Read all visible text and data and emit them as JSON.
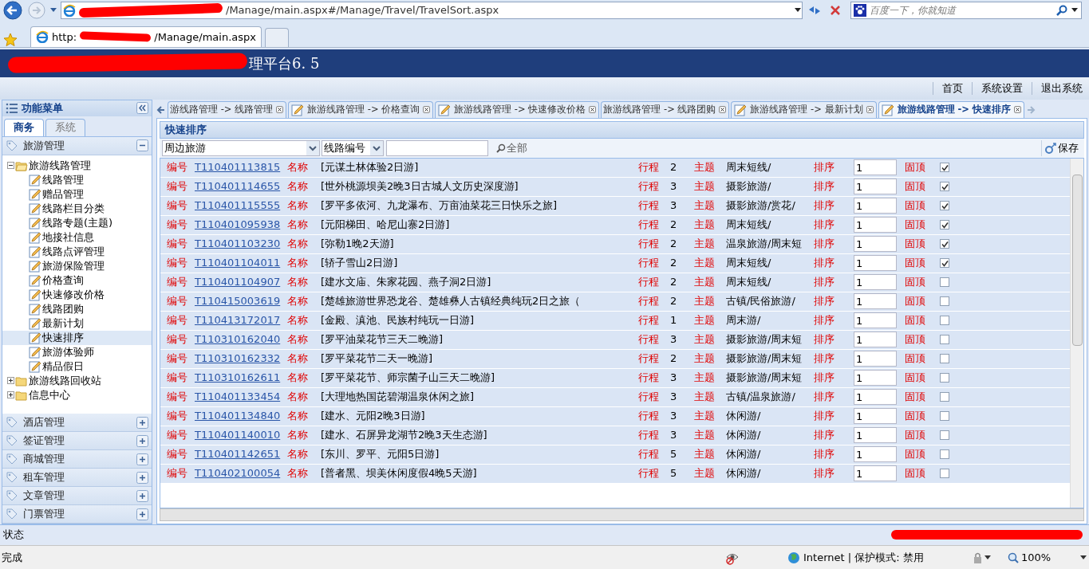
{
  "browser": {
    "address": "/Manage/main.aspx#/Manage/Travel/TravelSort.aspx",
    "search_placeholder": "百度一下，你就知道",
    "tabs": [
      {
        "label_start": "http:",
        "label_end": "/Manage/main.aspx",
        "selected": true
      }
    ]
  },
  "app": {
    "title": "理平台6. 5",
    "top_links": [
      "首页",
      "系统设置",
      "退出系统"
    ]
  },
  "sidebar": {
    "title": "功能菜单",
    "tabs": [
      {
        "label": "商务",
        "selected": true
      },
      {
        "label": "系统",
        "selected": false
      }
    ],
    "sections": [
      {
        "label": "旅游管理",
        "expanded": true,
        "tree": [
          {
            "label": "旅游线路管理",
            "expanded": true,
            "children": [
              {
                "label": "线路管理",
                "selected": false
              },
              {
                "label": "赠品管理",
                "selected": false
              },
              {
                "label": "线路栏目分类",
                "selected": false
              },
              {
                "label": "线路专题(主题)",
                "selected": false
              },
              {
                "label": "地接社信息",
                "selected": false
              },
              {
                "label": "线路点评管理",
                "selected": false
              },
              {
                "label": "旅游保险管理",
                "selected": false
              },
              {
                "label": "价格查询",
                "selected": false
              },
              {
                "label": "快速修改价格",
                "selected": false
              },
              {
                "label": "线路团购",
                "selected": false
              },
              {
                "label": "最新计划",
                "selected": false
              },
              {
                "label": "快速排序",
                "selected": true
              },
              {
                "label": "旅游体验师",
                "selected": false
              },
              {
                "label": "精品假日",
                "selected": false
              }
            ]
          },
          {
            "label": "旅游线路回收站",
            "expanded": false
          },
          {
            "label": "信息中心",
            "expanded": false
          }
        ]
      },
      {
        "label": "酒店管理",
        "expanded": false
      },
      {
        "label": "签证管理",
        "expanded": false
      },
      {
        "label": "商城管理",
        "expanded": false
      },
      {
        "label": "租车管理",
        "expanded": false
      },
      {
        "label": "文章管理",
        "expanded": false
      },
      {
        "label": "门票管理",
        "expanded": false
      }
    ]
  },
  "page_tabs": [
    {
      "label": "游线路管理 -> 线路管理",
      "icon": false,
      "selected": false
    },
    {
      "label": "旅游线路管理 -> 价格查询",
      "icon": true,
      "selected": false
    },
    {
      "label": "旅游线路管理 -> 快速修改价格",
      "icon": true,
      "selected": false
    },
    {
      "label": "旅游线路管理 -> 线路团购",
      "icon": false,
      "selected": false
    },
    {
      "label": "旅游线路管理 -> 最新计划",
      "icon": true,
      "selected": false
    },
    {
      "label": "旅游线路管理 -> 快速排序",
      "icon": true,
      "selected": true
    }
  ],
  "panel": {
    "title": "快速排序",
    "category": "周边旅游",
    "field": "线路编号",
    "search_button": "全部",
    "save_button": "保存",
    "rows": [
      {
        "code_label": "编号",
        "code": "T110401113815",
        "name_label": "名称",
        "name": "[元谋土林体验2日游]",
        "days_label": "行程",
        "days": "2",
        "theme_label": "主题",
        "theme": "周末短线/",
        "order_label": "排序",
        "order": "1",
        "top_label": "固顶",
        "pinned": true
      },
      {
        "code_label": "编号",
        "code": "T110401114655",
        "name_label": "名称",
        "name": "[世外桃源坝美2晚3日古城人文历史深度游]",
        "days_label": "行程",
        "days": "3",
        "theme_label": "主题",
        "theme": "摄影旅游/",
        "order_label": "排序",
        "order": "1",
        "top_label": "固顶",
        "pinned": true
      },
      {
        "code_label": "编号",
        "code": "T110401115555",
        "name_label": "名称",
        "name": "[罗平多依河、九龙瀑布、万亩油菜花三日快乐之旅]",
        "days_label": "行程",
        "days": "3",
        "theme_label": "主题",
        "theme": "摄影旅游/赏花/",
        "order_label": "排序",
        "order": "1",
        "top_label": "固顶",
        "pinned": true
      },
      {
        "code_label": "编号",
        "code": "T110401095938",
        "name_label": "名称",
        "name": "[元阳梯田、哈尼山寨2日游]",
        "days_label": "行程",
        "days": "2",
        "theme_label": "主题",
        "theme": "周末短线/",
        "order_label": "排序",
        "order": "1",
        "top_label": "固顶",
        "pinned": true
      },
      {
        "code_label": "编号",
        "code": "T110401103230",
        "name_label": "名称",
        "name": "[弥勒1晚2天游]",
        "days_label": "行程",
        "days": "2",
        "theme_label": "主题",
        "theme": "温泉旅游/周末短",
        "order_label": "排序",
        "order": "1",
        "top_label": "固顶",
        "pinned": true
      },
      {
        "code_label": "编号",
        "code": "T110401104011",
        "name_label": "名称",
        "name": "[轿子雪山2日游]",
        "days_label": "行程",
        "days": "2",
        "theme_label": "主题",
        "theme": "周末短线/",
        "order_label": "排序",
        "order": "1",
        "top_label": "固顶",
        "pinned": true
      },
      {
        "code_label": "编号",
        "code": "T110401104907",
        "name_label": "名称",
        "name": "[建水文庙、朱家花园、燕子洞2日游]",
        "days_label": "行程",
        "days": "2",
        "theme_label": "主题",
        "theme": "周末短线/",
        "order_label": "排序",
        "order": "1",
        "top_label": "固顶",
        "pinned": false
      },
      {
        "code_label": "编号",
        "code": "T110415003619",
        "name_label": "名称",
        "name": "[楚雄旅游世界恐龙谷、楚雄彝人古镇经典纯玩2日之旅（",
        "days_label": "行程",
        "days": "2",
        "theme_label": "主题",
        "theme": "古镇/民俗旅游/",
        "order_label": "排序",
        "order": "1",
        "top_label": "固顶",
        "pinned": false
      },
      {
        "code_label": "编号",
        "code": "T110413172017",
        "name_label": "名称",
        "name": "[金殿、滇池、民族村纯玩一日游]",
        "days_label": "行程",
        "days": "1",
        "theme_label": "主题",
        "theme": "周末游/",
        "order_label": "排序",
        "order": "1",
        "top_label": "固顶",
        "pinned": false
      },
      {
        "code_label": "编号",
        "code": "T110310162040",
        "name_label": "名称",
        "name": "[罗平油菜花节三天二晚游]",
        "days_label": "行程",
        "days": "3",
        "theme_label": "主题",
        "theme": "摄影旅游/周末短",
        "order_label": "排序",
        "order": "1",
        "top_label": "固顶",
        "pinned": false
      },
      {
        "code_label": "编号",
        "code": "T110310162332",
        "name_label": "名称",
        "name": "[罗平菜花节二天一晚游]",
        "days_label": "行程",
        "days": "2",
        "theme_label": "主题",
        "theme": "摄影旅游/周末短",
        "order_label": "排序",
        "order": "1",
        "top_label": "固顶",
        "pinned": false
      },
      {
        "code_label": "编号",
        "code": "T110310162611",
        "name_label": "名称",
        "name": "[罗平菜花节、师宗菌子山三天二晚游]",
        "days_label": "行程",
        "days": "3",
        "theme_label": "主题",
        "theme": "摄影旅游/周末短",
        "order_label": "排序",
        "order": "1",
        "top_label": "固顶",
        "pinned": false
      },
      {
        "code_label": "编号",
        "code": "T110401133454",
        "name_label": "名称",
        "name": "[大理地热国芘碧湖温泉休闲之旅]",
        "days_label": "行程",
        "days": "3",
        "theme_label": "主题",
        "theme": "古镇/温泉旅游/",
        "order_label": "排序",
        "order": "1",
        "top_label": "固顶",
        "pinned": false
      },
      {
        "code_label": "编号",
        "code": "T110401134840",
        "name_label": "名称",
        "name": "[建水、元阳2晚3日游]",
        "days_label": "行程",
        "days": "3",
        "theme_label": "主题",
        "theme": "休闲游/",
        "order_label": "排序",
        "order": "1",
        "top_label": "固顶",
        "pinned": false
      },
      {
        "code_label": "编号",
        "code": "T110401140010",
        "name_label": "名称",
        "name": "[建水、石屏异龙湖节2晚3天生态游]",
        "days_label": "行程",
        "days": "3",
        "theme_label": "主题",
        "theme": "休闲游/",
        "order_label": "排序",
        "order": "1",
        "top_label": "固顶",
        "pinned": false
      },
      {
        "code_label": "编号",
        "code": "T110401142651",
        "name_label": "名称",
        "name": "[东川、罗平、元阳5日游]",
        "days_label": "行程",
        "days": "5",
        "theme_label": "主题",
        "theme": "休闲游/",
        "order_label": "排序",
        "order": "1",
        "top_label": "固顶",
        "pinned": false
      },
      {
        "code_label": "编号",
        "code": "T110402100054",
        "name_label": "名称",
        "name": "[普者黑、坝美休闲度假4晚5天游]",
        "days_label": "行程",
        "days": "5",
        "theme_label": "主题",
        "theme": "休闲游/",
        "order_label": "排序",
        "order": "1",
        "top_label": "固顶",
        "pinned": false
      }
    ]
  },
  "status_bar": {
    "label": "状态"
  },
  "browser_status": {
    "text": "完成",
    "zone": "Internet | 保护模式: 禁用",
    "zoom": "100%"
  }
}
